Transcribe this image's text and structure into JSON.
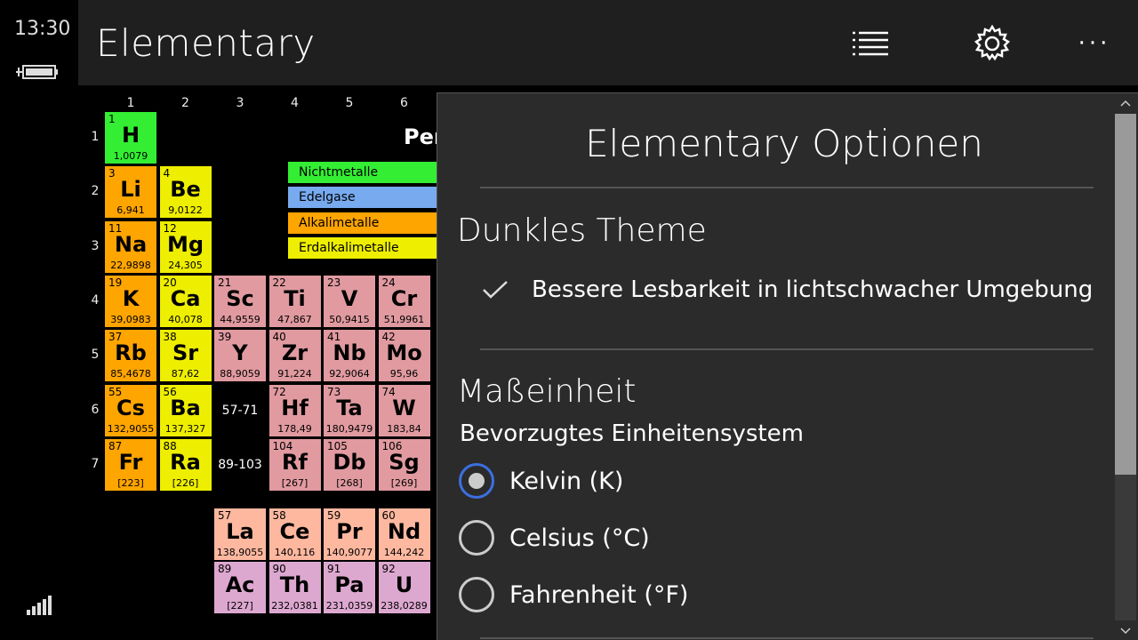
{
  "status": {
    "time": "13:30"
  },
  "header": {
    "title": "Elementary"
  },
  "table": {
    "columns": [
      "1",
      "2",
      "3",
      "4",
      "5",
      "6"
    ],
    "rows": [
      "1",
      "2",
      "3",
      "4",
      "5",
      "6",
      "7"
    ],
    "title_fragment": "Per",
    "placeholders": [
      "57-71",
      "89-103"
    ],
    "legend": [
      {
        "label": "Nichtmetalle",
        "color": "#33ee33"
      },
      {
        "label": "Edelgase",
        "color": "#77aaee"
      },
      {
        "label": "Alkalimetalle",
        "color": "#ffa500"
      },
      {
        "label": "Erdalkalimetalle",
        "color": "#eeee00"
      }
    ],
    "elements": [
      {
        "n": "1",
        "s": "H",
        "m": "1,0079",
        "c": "#33ee33"
      },
      {
        "n": "3",
        "s": "Li",
        "m": "6,941",
        "c": "#ffa500"
      },
      {
        "n": "4",
        "s": "Be",
        "m": "9,0122",
        "c": "#eeee00"
      },
      {
        "n": "11",
        "s": "Na",
        "m": "22,9898",
        "c": "#ffa500"
      },
      {
        "n": "12",
        "s": "Mg",
        "m": "24,305",
        "c": "#eeee00"
      },
      {
        "n": "19",
        "s": "K",
        "m": "39,0983",
        "c": "#ffa500"
      },
      {
        "n": "20",
        "s": "Ca",
        "m": "40,078",
        "c": "#eeee00"
      },
      {
        "n": "21",
        "s": "Sc",
        "m": "44,9559",
        "c": "#e09aa0"
      },
      {
        "n": "22",
        "s": "Ti",
        "m": "47,867",
        "c": "#e09aa0"
      },
      {
        "n": "23",
        "s": "V",
        "m": "50,9415",
        "c": "#e09aa0"
      },
      {
        "n": "24",
        "s": "Cr",
        "m": "51,9961",
        "c": "#e09aa0"
      },
      {
        "n": "37",
        "s": "Rb",
        "m": "85,4678",
        "c": "#ffa500"
      },
      {
        "n": "38",
        "s": "Sr",
        "m": "87,62",
        "c": "#eeee00"
      },
      {
        "n": "39",
        "s": "Y",
        "m": "88,9059",
        "c": "#e09aa0"
      },
      {
        "n": "40",
        "s": "Zr",
        "m": "91,224",
        "c": "#e09aa0"
      },
      {
        "n": "41",
        "s": "Nb",
        "m": "92,9064",
        "c": "#e09aa0"
      },
      {
        "n": "42",
        "s": "Mo",
        "m": "95,96",
        "c": "#e09aa0"
      },
      {
        "n": "55",
        "s": "Cs",
        "m": "132,9055",
        "c": "#ffa500"
      },
      {
        "n": "56",
        "s": "Ba",
        "m": "137,327",
        "c": "#eeee00"
      },
      {
        "n": "72",
        "s": "Hf",
        "m": "178,49",
        "c": "#e09aa0"
      },
      {
        "n": "73",
        "s": "Ta",
        "m": "180,9479",
        "c": "#e09aa0"
      },
      {
        "n": "74",
        "s": "W",
        "m": "183,84",
        "c": "#e09aa0"
      },
      {
        "n": "87",
        "s": "Fr",
        "m": "[223]",
        "c": "#ffa500"
      },
      {
        "n": "88",
        "s": "Ra",
        "m": "[226]",
        "c": "#eeee00"
      },
      {
        "n": "104",
        "s": "Rf",
        "m": "[267]",
        "c": "#e09aa0"
      },
      {
        "n": "105",
        "s": "Db",
        "m": "[268]",
        "c": "#e09aa0"
      },
      {
        "n": "106",
        "s": "Sg",
        "m": "[269]",
        "c": "#e09aa0"
      },
      {
        "n": "57",
        "s": "La",
        "m": "138,9055",
        "c": "#ffb8a0"
      },
      {
        "n": "58",
        "s": "Ce",
        "m": "140,116",
        "c": "#ffb8a0"
      },
      {
        "n": "59",
        "s": "Pr",
        "m": "140,9077",
        "c": "#ffb8a0"
      },
      {
        "n": "60",
        "s": "Nd",
        "m": "144,242",
        "c": "#ffb8a0"
      },
      {
        "n": "89",
        "s": "Ac",
        "m": "[227]",
        "c": "#dda8d0"
      },
      {
        "n": "90",
        "s": "Th",
        "m": "232,0381",
        "c": "#dda8d0"
      },
      {
        "n": "91",
        "s": "Pa",
        "m": "231,0359",
        "c": "#dda8d0"
      },
      {
        "n": "92",
        "s": "U",
        "m": "238,0289",
        "c": "#dda8d0"
      }
    ]
  },
  "options": {
    "title": "Elementary Optionen",
    "theme": {
      "title": "Dunkles Theme",
      "checkbox_label": "Bessere Lesbarkeit in lichtschwacher Umgebung",
      "checked": true
    },
    "units": {
      "title": "Maßeinheit",
      "subtitle": "Bevorzugtes Einheitensystem",
      "selected": "Kelvin (K)",
      "choices": [
        "Kelvin (K)",
        "Celsius (°C)",
        "Fahrenheit (°F)"
      ]
    }
  },
  "colors": {
    "accent": "#3c6fe0",
    "panel": "#2b2b2b",
    "header": "#1f1f1f"
  }
}
